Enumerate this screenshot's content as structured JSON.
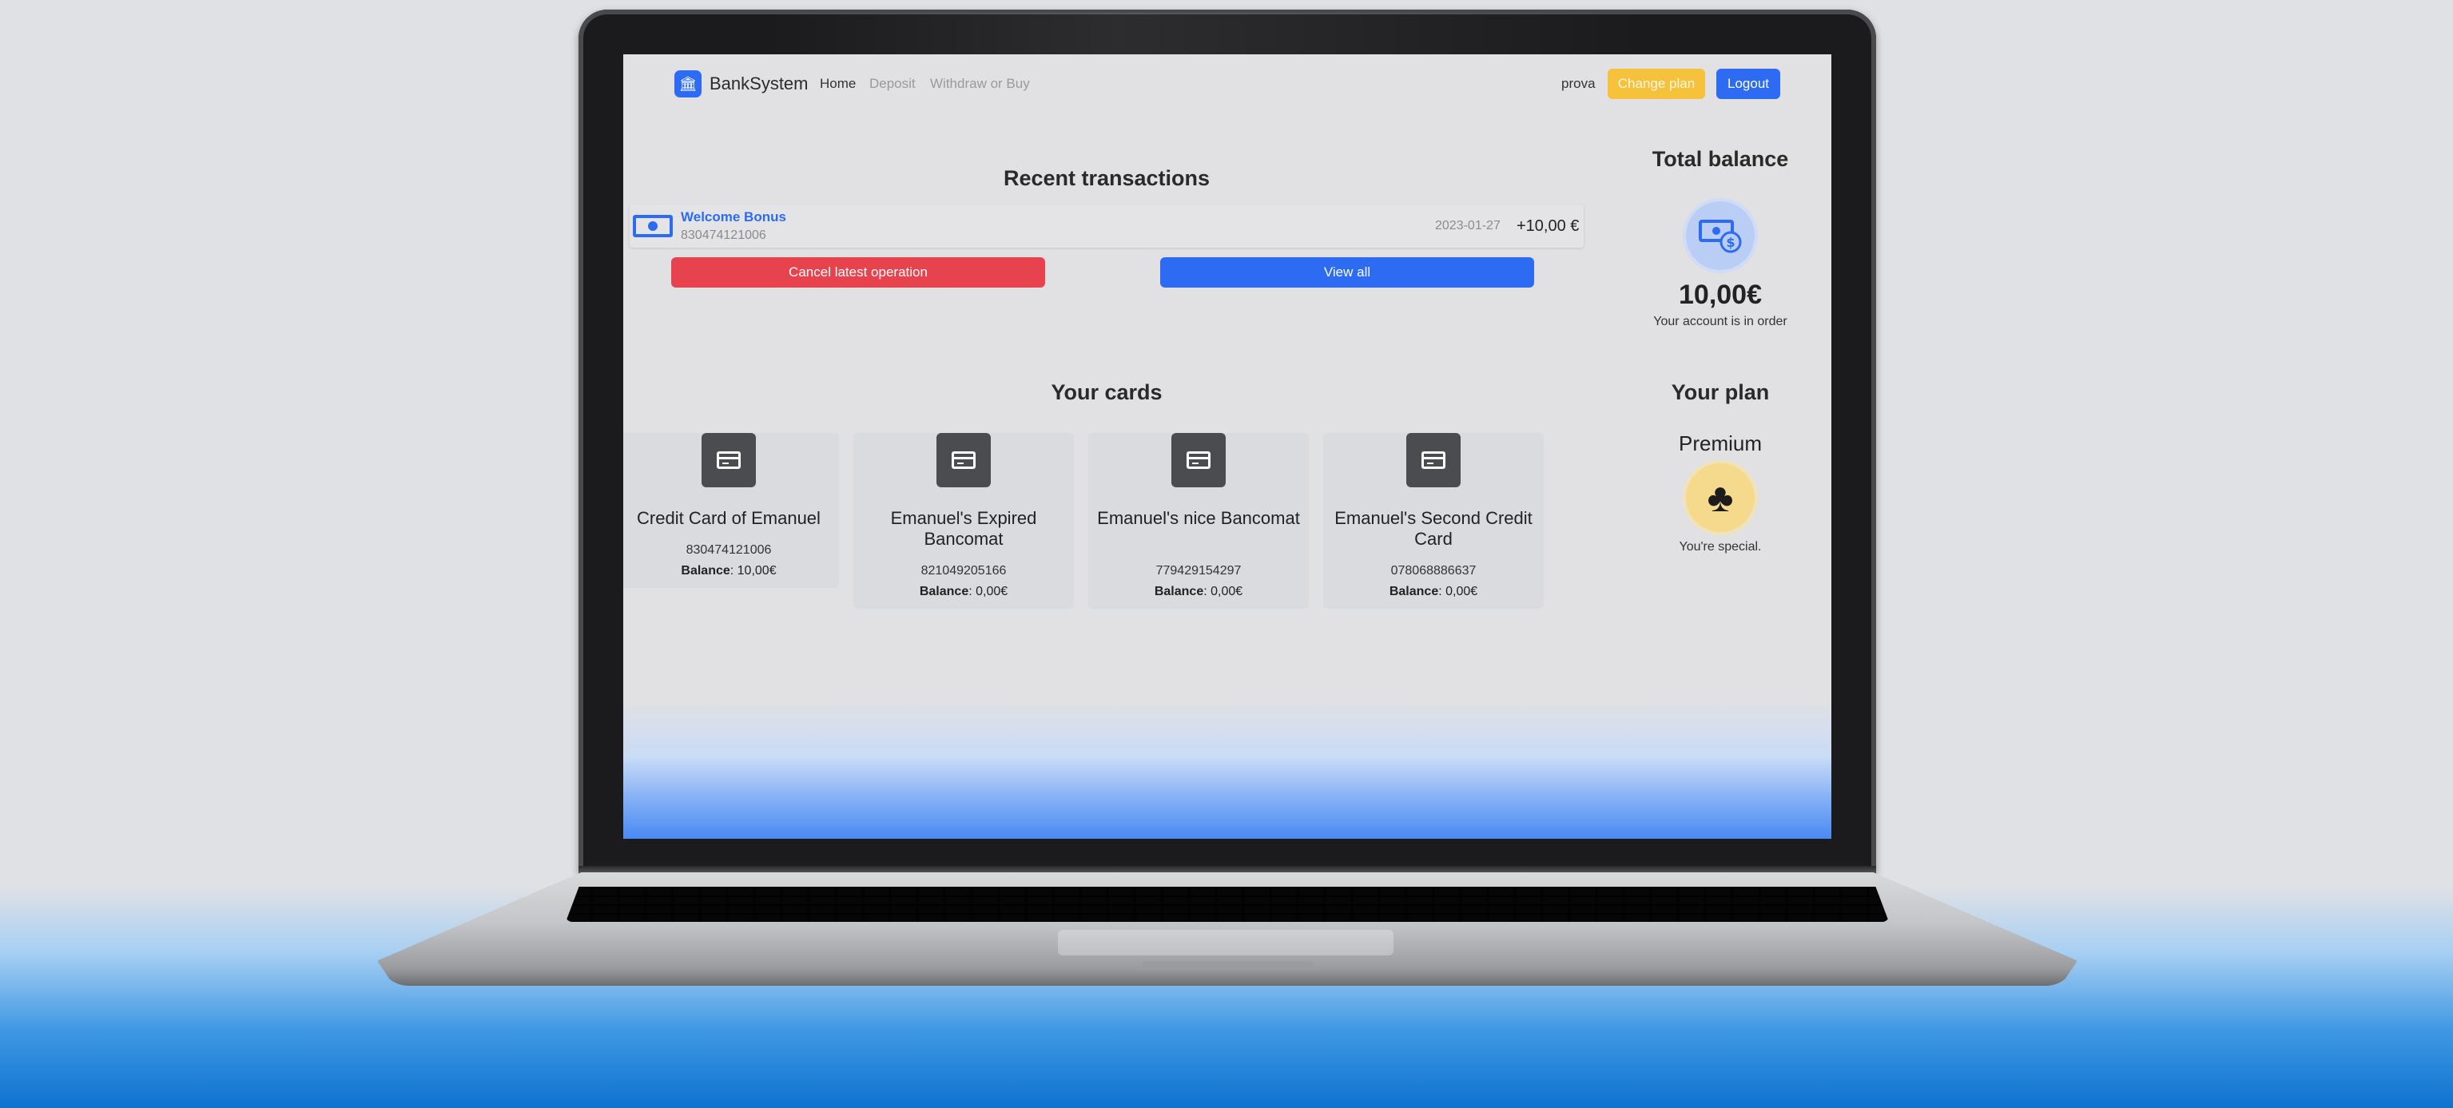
{
  "app": {
    "brand": "BankSystem",
    "nav": [
      {
        "label": "Home"
      },
      {
        "label": "Deposit"
      },
      {
        "label": "Withdraw or Buy"
      }
    ],
    "username": "prova",
    "change_plan_label": "Change plan",
    "logout_label": "Logout"
  },
  "transactions": {
    "title": "Recent transactions",
    "items": [
      {
        "title": "Welcome Bonus",
        "account": "830474121006",
        "date": "2023-01-27",
        "amount": "+10,00 €"
      }
    ],
    "cancel_label": "Cancel latest operation",
    "view_all_label": "View all"
  },
  "balance": {
    "title": "Total balance",
    "amount": "10,00€",
    "note": "Your account is in order"
  },
  "cards": {
    "title": "Your cards",
    "balance_label": "Balance",
    "items": [
      {
        "name": "Credit Card of Emanuel",
        "number": "830474121006",
        "balance": ": 10,00€"
      },
      {
        "name": "Emanuel's Expired Bancomat",
        "number": "821049205166",
        "balance": ": 0,00€"
      },
      {
        "name": "Emanuel's nice Bancomat",
        "number": "779429154297",
        "balance": ": 0,00€"
      },
      {
        "name": "Emanuel's Second Credit Card",
        "number": "078068886637",
        "balance": ": 0,00€"
      }
    ]
  },
  "plan": {
    "title": "Your plan",
    "name": "Premium",
    "note": "You're special."
  },
  "colors": {
    "primary": "#2d6cf2",
    "danger": "#e6434f",
    "warning": "#f6c23c"
  }
}
